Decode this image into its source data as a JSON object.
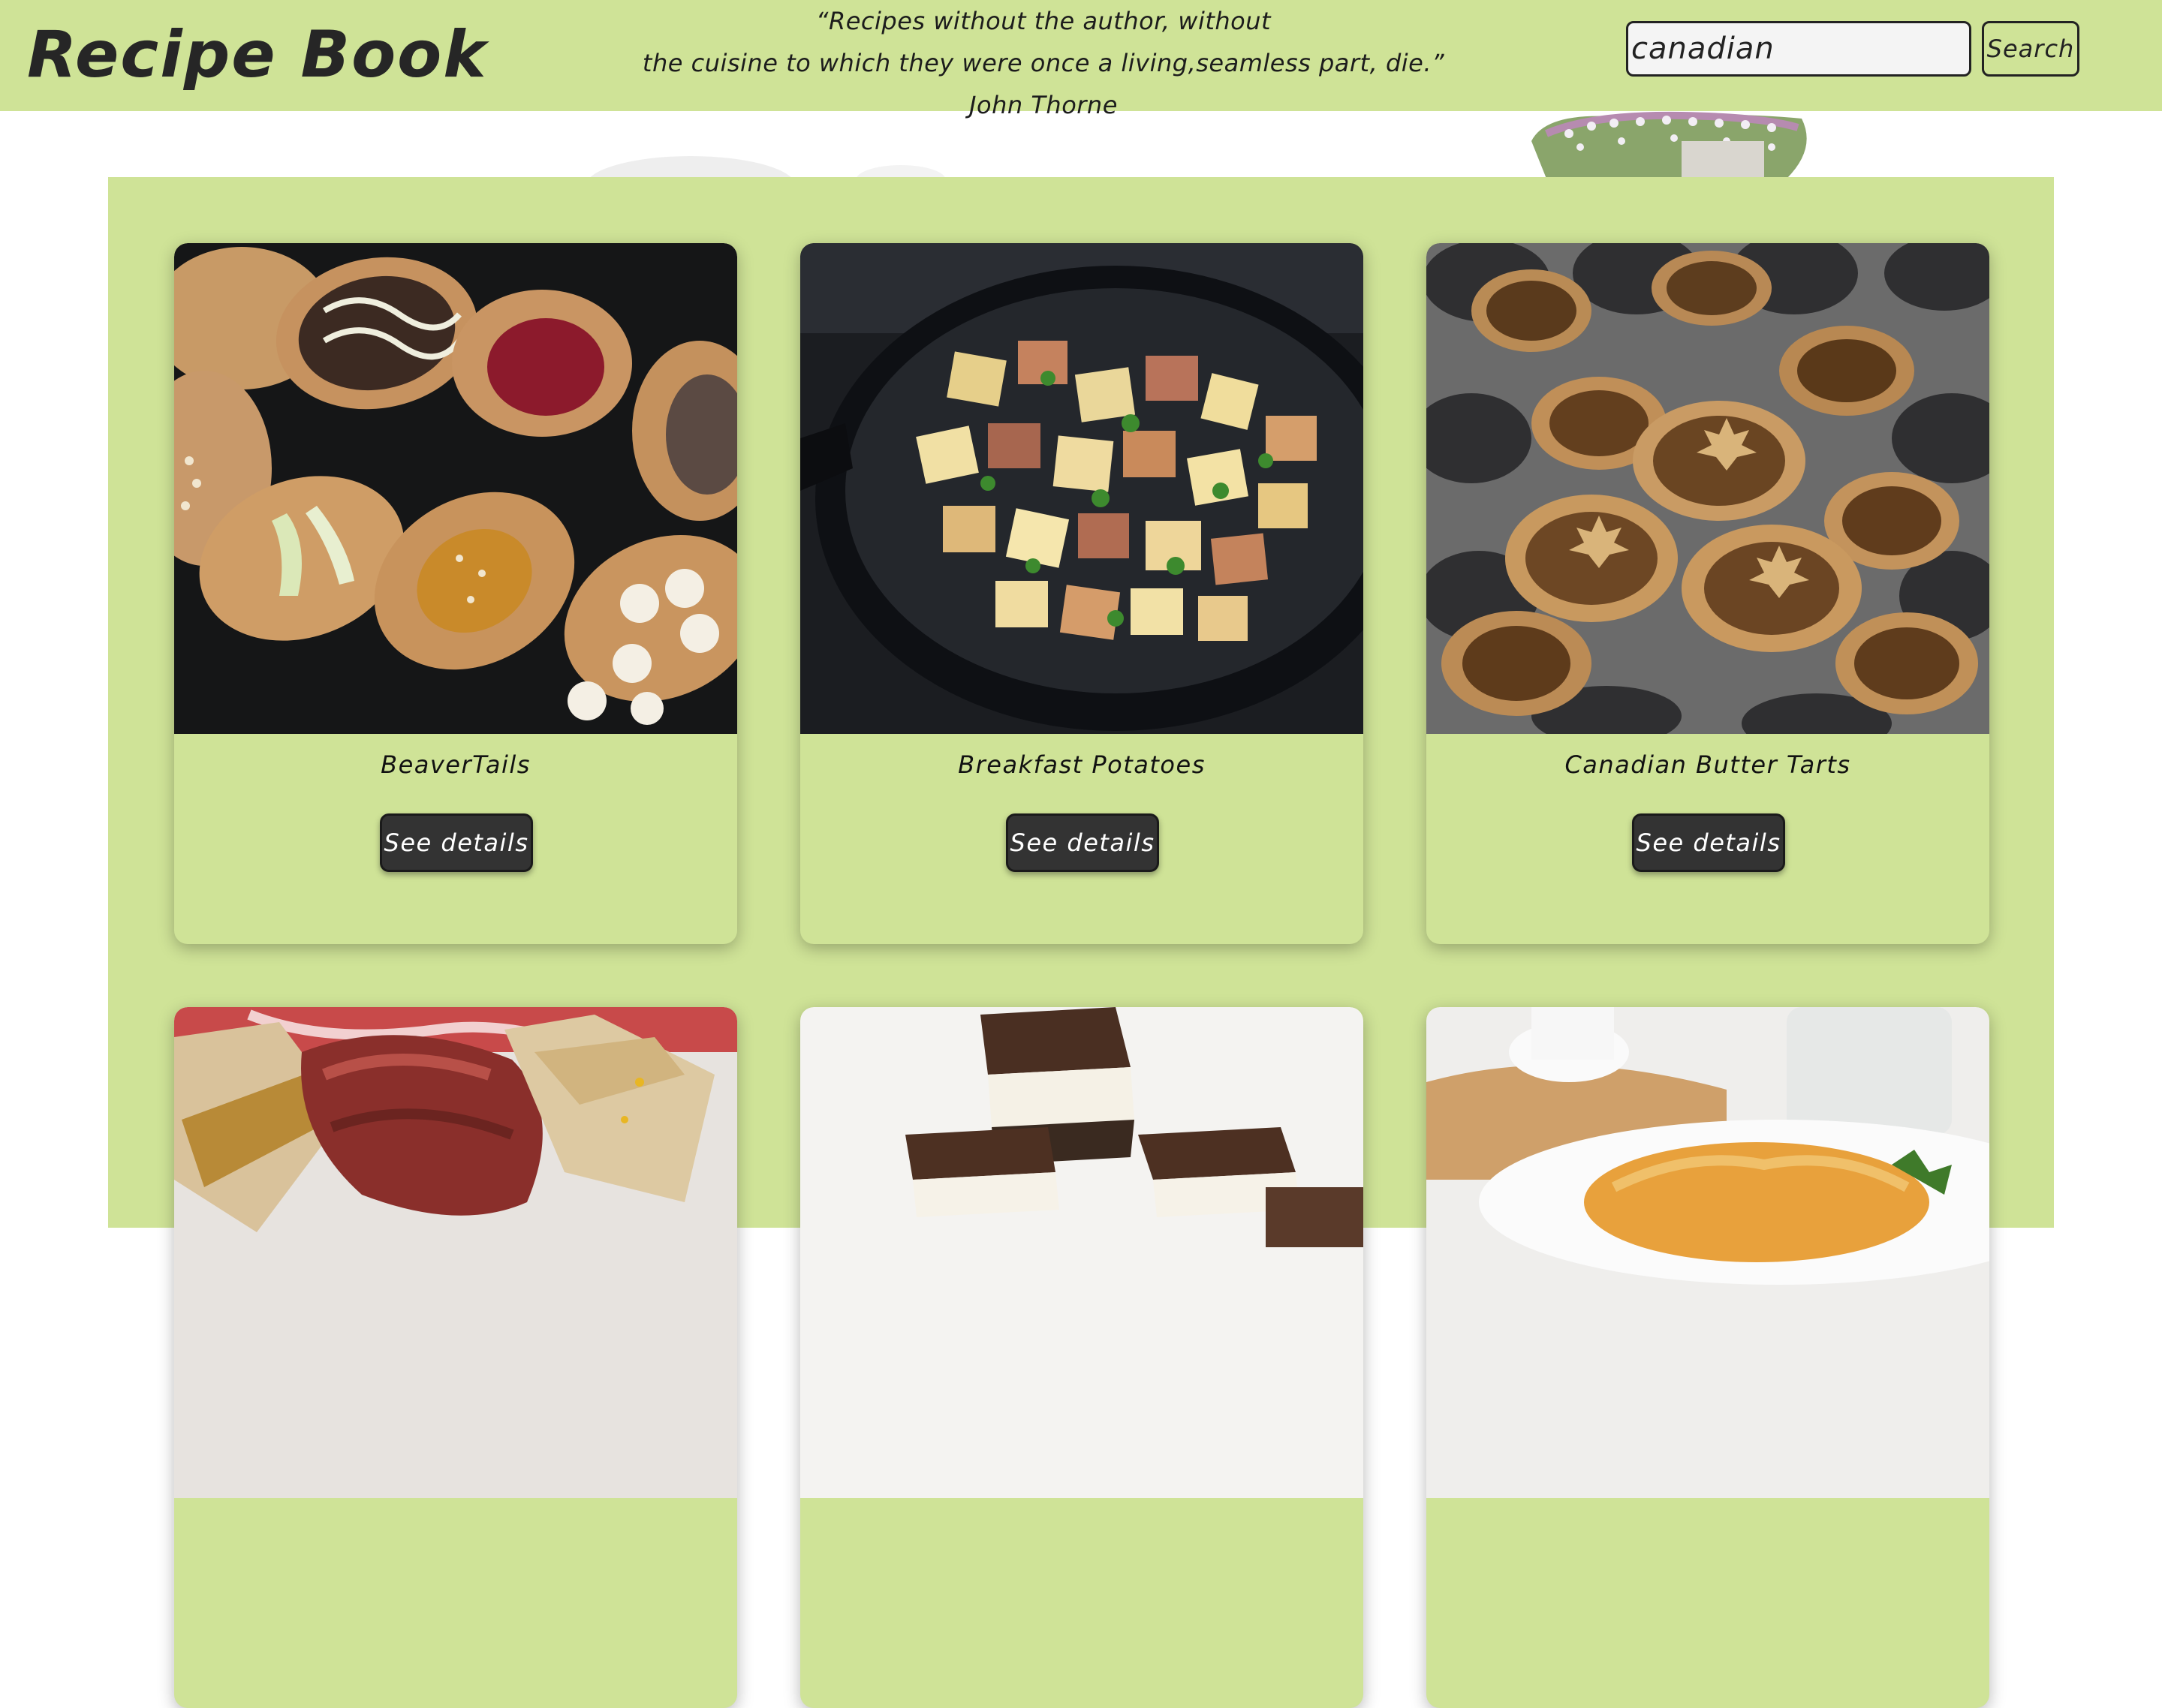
{
  "header": {
    "logo": "Recipe Book",
    "quote_line1": "“Recipes without the author, without",
    "quote_line2": "the cuisine to which they were once a living,seamless part, die.”",
    "quote_author": "John Thorne"
  },
  "search": {
    "value": "canadian",
    "button_label": "Search"
  },
  "recipes": [
    {
      "title": "BeaverTails",
      "button_label": "See details",
      "image_icon": "beavertails-photo"
    },
    {
      "title": "Breakfast Potatoes",
      "button_label": "See details",
      "image_icon": "breakfast-potatoes-photo"
    },
    {
      "title": "Canadian Butter Tarts",
      "button_label": "See details",
      "image_icon": "butter-tarts-photo"
    },
    {
      "title": "",
      "button_label": "",
      "image_icon": "smoked-meat-sandwich-photo"
    },
    {
      "title": "",
      "button_label": "",
      "image_icon": "nanaimo-bars-photo"
    },
    {
      "title": "",
      "button_label": "",
      "image_icon": "baked-casserole-photo"
    }
  ],
  "colors": {
    "header_bg": "#cfe397",
    "panel_bg": "#cfe397",
    "button_bg": "#333333",
    "text": "#1c1c1c"
  }
}
